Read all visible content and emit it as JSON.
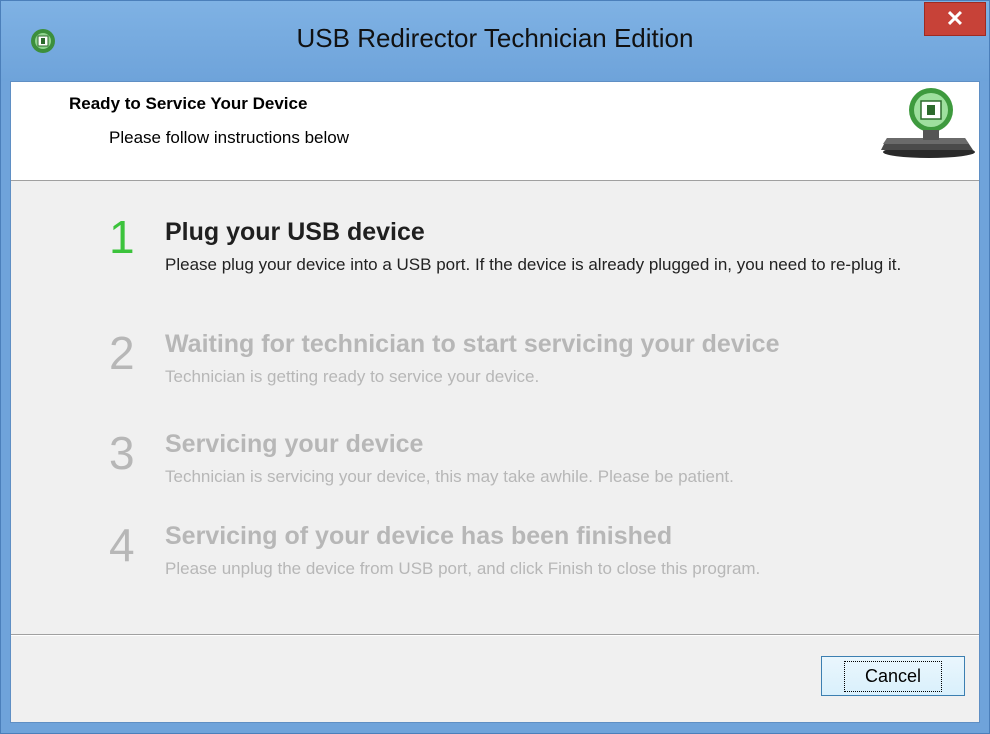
{
  "window": {
    "title": "USB Redirector Technician Edition",
    "close_glyph": "✕",
    "app_icon": "usb-redirector-icon"
  },
  "header": {
    "title": "Ready to Service Your Device",
    "subtitle": "Please follow instructions below",
    "icon": "usb-device-icon"
  },
  "steps": [
    {
      "number": "1",
      "title": "Plug your USB device",
      "description": "Please plug your device into a USB port. If the device is already plugged in, you need to re-plug it.",
      "state": "active"
    },
    {
      "number": "2",
      "title": "Waiting for technician to start servicing your device",
      "description": "Technician is getting ready to service your device.",
      "state": "inactive"
    },
    {
      "number": "3",
      "title": "Servicing your device",
      "description": "Technician is servicing your device, this may take awhile. Please be patient.",
      "state": "inactive"
    },
    {
      "number": "4",
      "title": "Servicing of your device has been finished",
      "description": "Please unplug the device from USB port, and click Finish to close this program.",
      "state": "inactive"
    }
  ],
  "footer": {
    "cancel_label": "Cancel"
  },
  "colors": {
    "active_number": "#3cc33c",
    "inactive_text": "#b7b7b7",
    "titlebar": "#6ea3da",
    "close_button": "#c74238"
  }
}
